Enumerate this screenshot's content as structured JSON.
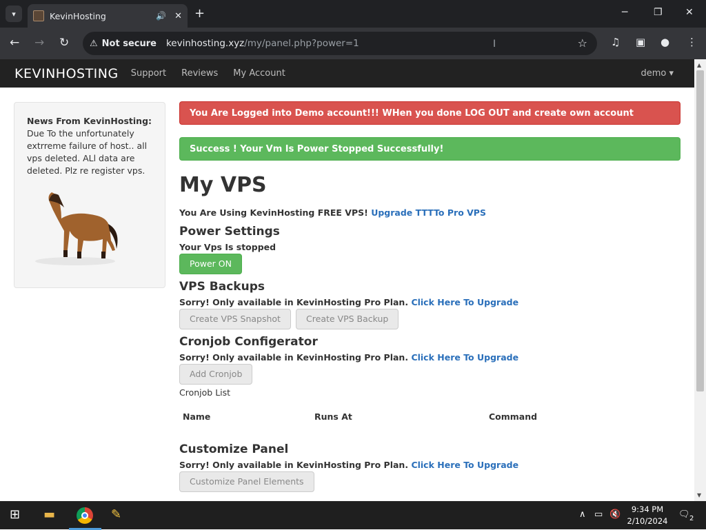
{
  "browser": {
    "tab_title": "KevinHosting",
    "security_label": "Not secure",
    "url_host": "kevinhosting.xyz",
    "url_path": "/my/panel.php?power=1"
  },
  "site": {
    "brand": "KEVINHOSTING",
    "nav": [
      "Support",
      "Reviews",
      "My Account"
    ],
    "user": "demo"
  },
  "news": {
    "heading": "News From KevinHosting:",
    "body": "Due To the unfortunately extrreme failure of host.. all vps deleted. ALl data are deleted. Plz re register vps."
  },
  "alerts": {
    "danger": "You Are Logged into Demo account!!! WHen you done LOG OUT and create own account",
    "success": "Success ! Your Vm Is Power Stopped Successfully!"
  },
  "main": {
    "title": "My VPS",
    "using_text": "You Are Using KevinHosting FREE VPS!",
    "upgrade_link": "Upgrade TTTTo Pro VPS",
    "power_heading": "Power Settings",
    "power_status": "Your Vps Is stopped",
    "power_button": "Power ON",
    "backups_heading": "VPS Backups",
    "sorry_text": "Sorry! Only available in KevinHosting Pro Plan.",
    "upgrade_here": "Click Here To Upgrade",
    "snapshot_button": "Create VPS Snapshot",
    "backup_button": "Create VPS Backup",
    "cron_heading": "Cronjob Configerator",
    "add_cron_button": "Add Cronjob",
    "cron_list_label": "Cronjob List",
    "cron_columns": [
      "Name",
      "Runs At",
      "Command"
    ],
    "customize_heading": "Customize Panel",
    "customize_button": "Customize Panel Elements"
  },
  "taskbar": {
    "time": "9:34 PM",
    "date": "2/10/2024",
    "notifications": "2"
  }
}
